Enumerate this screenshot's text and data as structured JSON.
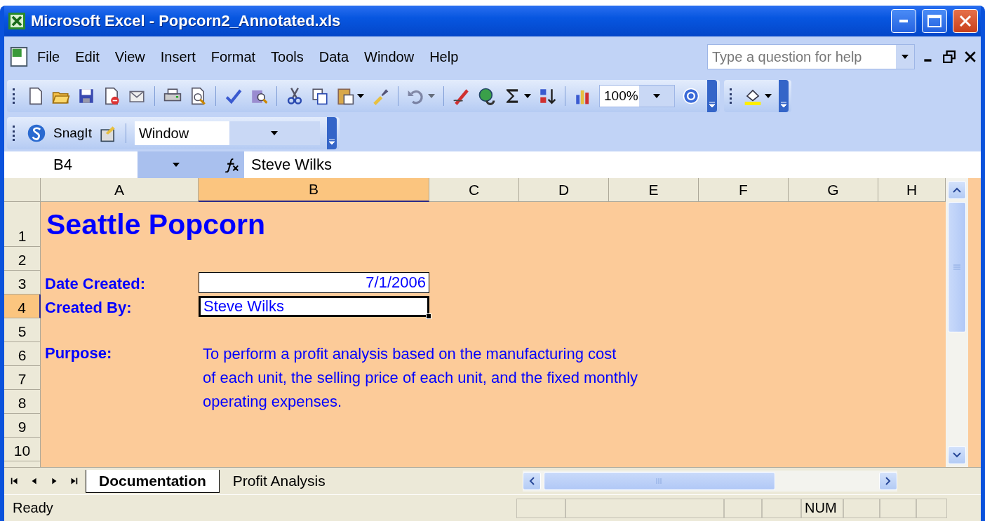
{
  "window": {
    "title": "Microsoft Excel - Popcorn2_Annotated.xls"
  },
  "menu": [
    {
      "label": "File"
    },
    {
      "label": "Edit"
    },
    {
      "label": "View"
    },
    {
      "label": "Insert"
    },
    {
      "label": "Format"
    },
    {
      "label": "Tools"
    },
    {
      "label": "Data"
    },
    {
      "label": "Window"
    },
    {
      "label": "Help"
    }
  ],
  "help_box": {
    "placeholder": "Type a question for help"
  },
  "toolbar": {
    "zoom": "100%"
  },
  "snagit_toolbar": {
    "label": "SnagIt",
    "dropdown": "Window"
  },
  "formula_bar": {
    "name_box": "B4",
    "value": "Steve Wilks"
  },
  "columns": [
    {
      "label": "A",
      "selected": false
    },
    {
      "label": "B",
      "selected": true
    },
    {
      "label": "C",
      "selected": false
    },
    {
      "label": "D",
      "selected": false
    },
    {
      "label": "E",
      "selected": false
    },
    {
      "label": "F",
      "selected": false
    },
    {
      "label": "G",
      "selected": false
    },
    {
      "label": "H",
      "selected": false
    }
  ],
  "rows": [
    {
      "label": "1",
      "selected": false
    },
    {
      "label": "2",
      "selected": false
    },
    {
      "label": "3",
      "selected": false
    },
    {
      "label": "4",
      "selected": true
    },
    {
      "label": "5",
      "selected": false
    },
    {
      "label": "6",
      "selected": false
    },
    {
      "label": "7",
      "selected": false
    },
    {
      "label": "8",
      "selected": false
    },
    {
      "label": "9",
      "selected": false
    },
    {
      "label": "10",
      "selected": false
    }
  ],
  "sheet": {
    "title": "Seattle Popcorn",
    "fields": [
      {
        "label": "Date Created:",
        "value": "7/1/2006",
        "kind": "date",
        "selected": false
      },
      {
        "label": "Created By:",
        "value": "Steve Wilks",
        "kind": "text",
        "selected": true
      }
    ],
    "purpose_label": "Purpose:",
    "purpose_lines": [
      "To perform a profit analysis based on the manufacturing cost",
      "of each unit, the selling price of each unit, and the fixed monthly",
      "operating expenses."
    ]
  },
  "sheet_tabs": [
    {
      "label": "Documentation",
      "selected": true
    },
    {
      "label": "Profit Analysis",
      "selected": false
    }
  ],
  "status_bar": {
    "text": "Ready",
    "num": "NUM"
  }
}
